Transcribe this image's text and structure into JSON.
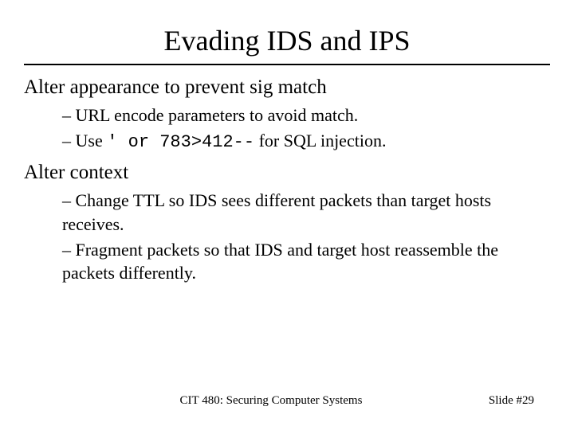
{
  "title": "Evading IDS and IPS",
  "section1": {
    "heading": "Alter appearance to prevent sig match",
    "b1": "– URL encode parameters to avoid match.",
    "b2a": "– Use ",
    "b2code": "' or 783>412--",
    "b2b": " for SQL injection."
  },
  "section2": {
    "heading": "Alter context",
    "b1": "– Change TTL so IDS sees different packets than target hosts receives.",
    "b2": "– Fragment packets so that IDS and target host reassemble the packets differently."
  },
  "footer": {
    "center": "CIT 480: Securing Computer Systems",
    "right": "Slide #29"
  }
}
